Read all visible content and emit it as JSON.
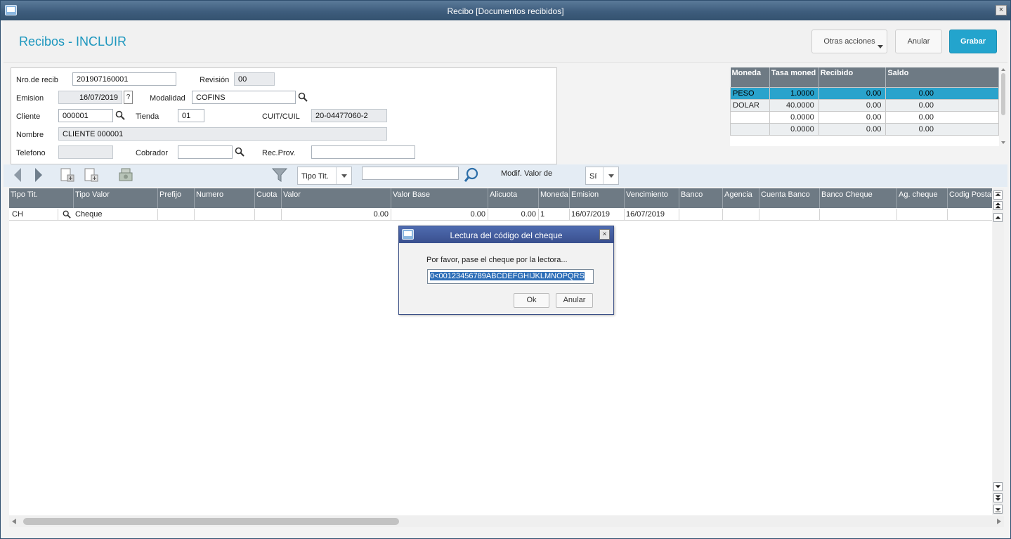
{
  "window": {
    "title": "Recibo [Documentos recibidos]",
    "close_label": "×"
  },
  "header": {
    "page_title": "Recibos - INCLUIR",
    "otras_label": "Otras acciones",
    "anular_label": "Anular",
    "grabar_label": "Grabar"
  },
  "form": {
    "nro_label": "Nro.de recib",
    "nro_value": "201907160001",
    "revision_label": "Revisión",
    "revision_value": "00",
    "emision_label": "Emision",
    "emision_value": "16/07/2019",
    "help_label": "?",
    "modalidad_label": "Modalidad",
    "modalidad_value": "COFINS",
    "cliente_label": "Cliente",
    "cliente_value": "000001",
    "tienda_label": "Tienda",
    "tienda_value": "01",
    "cuit_label": "CUIT/CUIL",
    "cuit_value": "20-04477060-2",
    "nombre_label": "Nombre",
    "nombre_value": "CLIENTE 000001",
    "telefono_label": "Telefono",
    "telefono_value": "",
    "cobrador_label": "Cobrador",
    "cobrador_value": "",
    "recprov_label": "Rec.Prov.",
    "recprov_value": ""
  },
  "money_table": {
    "headers": [
      "Moneda",
      "Tasa moned",
      "Recibido",
      "Saldo"
    ],
    "rows": [
      [
        "PESO",
        "1.0000",
        "0.00",
        "0.00"
      ],
      [
        "DOLAR",
        "40.0000",
        "0.00",
        "0.00"
      ],
      [
        "",
        "0.0000",
        "0.00",
        "0.00"
      ],
      [
        "",
        "0.0000",
        "0.00",
        "0.00"
      ]
    ]
  },
  "toolbar": {
    "tipo_combo": "Tipo Tit.",
    "search_value": "",
    "modif_label": "Modif. Valor de",
    "modif_value": "Sí"
  },
  "grid": {
    "headers": [
      "Tipo Tit.",
      "Tipo Valor",
      "Prefijo",
      "Numero",
      "Cuota",
      "Valor",
      "Valor Base",
      "Alicuota",
      "Moneda",
      "Emision",
      "Vencimiento",
      "Banco",
      "Agencia",
      "Cuenta Banco",
      "Banco Cheque",
      "Ag. cheque",
      "Codig Postal"
    ],
    "row": {
      "tipo_tit": "CH",
      "tipo_valor": "Cheque",
      "prefijo": "",
      "numero": "",
      "cuota": "",
      "valor": "0.00",
      "valor_base": "0.00",
      "alicuota": "0.00",
      "moneda": "1",
      "emision": "16/07/2019",
      "vencimiento": "16/07/2019"
    }
  },
  "dialog": {
    "title": "Lectura del código del cheque",
    "close_label": "×",
    "message": "Por favor, pase el cheque por la lectora...",
    "input_value": "0<00123456789ABCDEFGHIJKLMNOPQRS",
    "ok_label": "Ok",
    "anular_label": "Anular"
  },
  "colors": {
    "accent": "#23a4cd",
    "header_bar": "#6e7a84",
    "selected_row": "#2aa3cc"
  }
}
